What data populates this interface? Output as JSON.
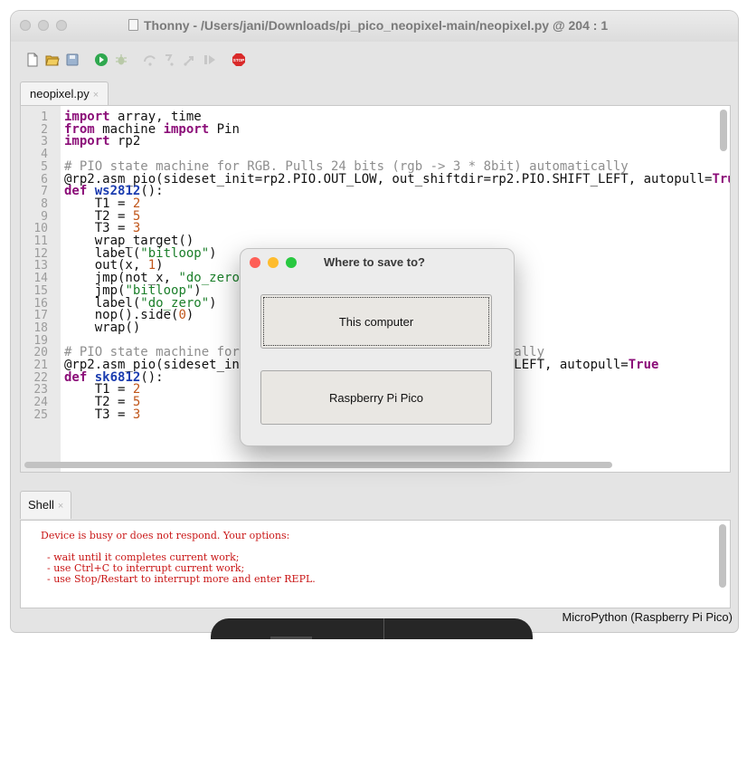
{
  "window": {
    "title": "Thonny  -  /Users/jani/Downloads/pi_pico_neopixel-main/neopixel.py  @  204 : 1"
  },
  "toolbar": {
    "buttons": [
      "new-file-icon",
      "open-file-icon",
      "save-file-icon",
      "run-icon",
      "debug-icon",
      "step-over-icon",
      "step-into-icon",
      "step-out-icon",
      "resume-icon",
      "stop-icon"
    ],
    "stop_label": "STOP"
  },
  "editor": {
    "tab_label": "neopixel.py",
    "tab_close": "×"
  },
  "shell": {
    "tab_label": "Shell",
    "tab_close": "×",
    "lines": [
      "Device is busy or does not respond. Your options:",
      "  - wait until it completes current work;",
      "  - use Ctrl+C to interrupt current work;",
      "  - use Stop/Restart to interrupt more and enter REPL."
    ]
  },
  "status": {
    "interpreter": "MicroPython (Raspberry Pi Pico)"
  },
  "dialog": {
    "title": "Where to save to?",
    "option_computer": "This computer",
    "option_pico": "Raspberry Pi Pico"
  },
  "colors": {
    "keyword": "#8b0d78",
    "function_name": "#1a3cb0",
    "number": "#c0561a",
    "string": "#1b7f2a",
    "comment": "#8e8e8e",
    "shell_error": "#c91616",
    "traffic_red": "#fe5f57",
    "traffic_yellow": "#febc2e",
    "traffic_green": "#28c840"
  }
}
